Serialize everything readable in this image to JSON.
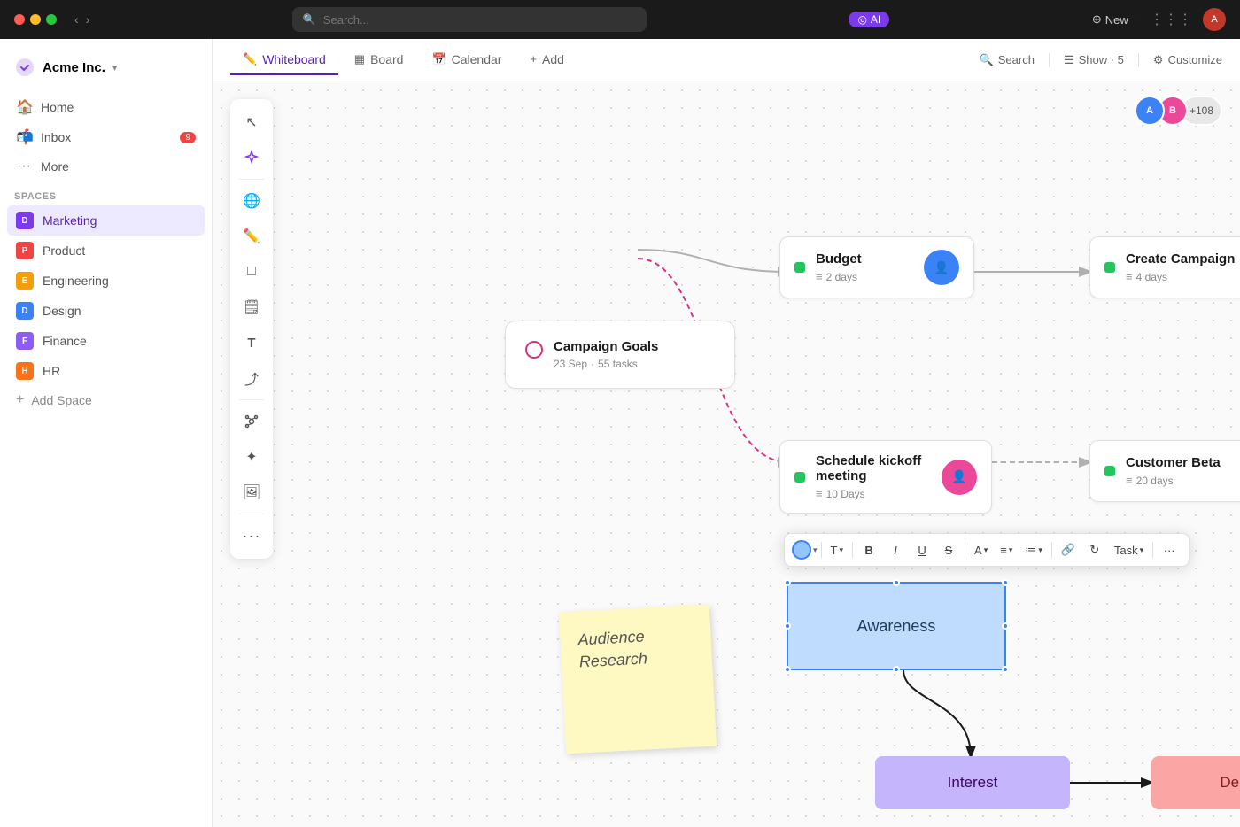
{
  "topbar": {
    "search_placeholder": "Search...",
    "ai_label": "AI",
    "new_label": "New"
  },
  "sidebar": {
    "brand": "Acme Inc.",
    "nav": [
      {
        "id": "home",
        "label": "Home",
        "icon": "🏠"
      },
      {
        "id": "inbox",
        "label": "Inbox",
        "icon": "📬",
        "badge": "9"
      },
      {
        "id": "more",
        "label": "More",
        "icon": "●●●"
      }
    ],
    "section_label": "Spaces",
    "spaces": [
      {
        "id": "marketing",
        "label": "Marketing",
        "initial": "D",
        "color": "#7c3aed",
        "active": true
      },
      {
        "id": "product",
        "label": "Product",
        "initial": "P",
        "color": "#ef4444"
      },
      {
        "id": "engineering",
        "label": "Engineering",
        "initial": "E",
        "color": "#f59e0b"
      },
      {
        "id": "design",
        "label": "Design",
        "initial": "D",
        "color": "#3b82f6"
      },
      {
        "id": "finance",
        "label": "Finance",
        "initial": "F",
        "color": "#8b5cf6"
      },
      {
        "id": "hr",
        "label": "HR",
        "initial": "H",
        "color": "#f97316"
      }
    ],
    "add_space": "Add Space"
  },
  "tabs": [
    {
      "id": "whiteboard",
      "label": "Whiteboard",
      "icon": "✏️",
      "active": true
    },
    {
      "id": "board",
      "label": "Board",
      "icon": "▦"
    },
    {
      "id": "calendar",
      "label": "Calendar",
      "icon": "📅"
    },
    {
      "id": "add",
      "label": "Add",
      "icon": "+"
    }
  ],
  "tabbar_right": {
    "search": "Search",
    "show": "Show · 5",
    "customize": "Customize"
  },
  "whiteboard": {
    "avatars_count": "+108",
    "cards": {
      "budget": {
        "title": "Budget",
        "sub": "2 days",
        "avatar_bg": "#3b82f6"
      },
      "create_campaign": {
        "title": "Create Campaign",
        "sub": "4 days",
        "avatar_bg": "#f59e0b"
      },
      "campaign_goals": {
        "title": "Campaign Goals",
        "date": "23 Sep",
        "tasks": "55 tasks"
      },
      "schedule_kickoff": {
        "title": "Schedule kickoff meeting",
        "sub": "10 Days",
        "avatar_bg": "#ec4899"
      },
      "customer_beta": {
        "title": "Customer Beta",
        "sub": "20 days",
        "avatar_bg": "#22c55e"
      }
    },
    "shapes": {
      "sticky_note": {
        "line1": "Audience",
        "line2": "Research"
      },
      "awareness": "Awareness",
      "interest": "Interest",
      "decision": "Decision"
    }
  },
  "toolbar": {
    "tools": [
      {
        "id": "select",
        "icon": "↖",
        "label": "Select"
      },
      {
        "id": "magic",
        "icon": "✦",
        "label": "Magic"
      },
      {
        "id": "globe",
        "icon": "🌐",
        "label": "Globe"
      },
      {
        "id": "pencil",
        "icon": "✏️",
        "label": "Pencil"
      },
      {
        "id": "shape",
        "icon": "□",
        "label": "Shape"
      },
      {
        "id": "sticky",
        "icon": "📝",
        "label": "Sticky"
      },
      {
        "id": "text",
        "icon": "T",
        "label": "Text"
      },
      {
        "id": "arrow",
        "icon": "⤴",
        "label": "Arrow"
      },
      {
        "id": "network",
        "icon": "◉",
        "label": "Network"
      },
      {
        "id": "sparkle",
        "icon": "✦",
        "label": "Sparkle"
      },
      {
        "id": "image",
        "icon": "🖼",
        "label": "Image"
      },
      {
        "id": "more",
        "icon": "···",
        "label": "More"
      }
    ]
  },
  "format_toolbar": {
    "task_label": "Task",
    "buttons": [
      "T",
      "B",
      "I",
      "U",
      "S",
      "A",
      "≡",
      "≔",
      "🔗",
      "↻",
      "···"
    ]
  }
}
